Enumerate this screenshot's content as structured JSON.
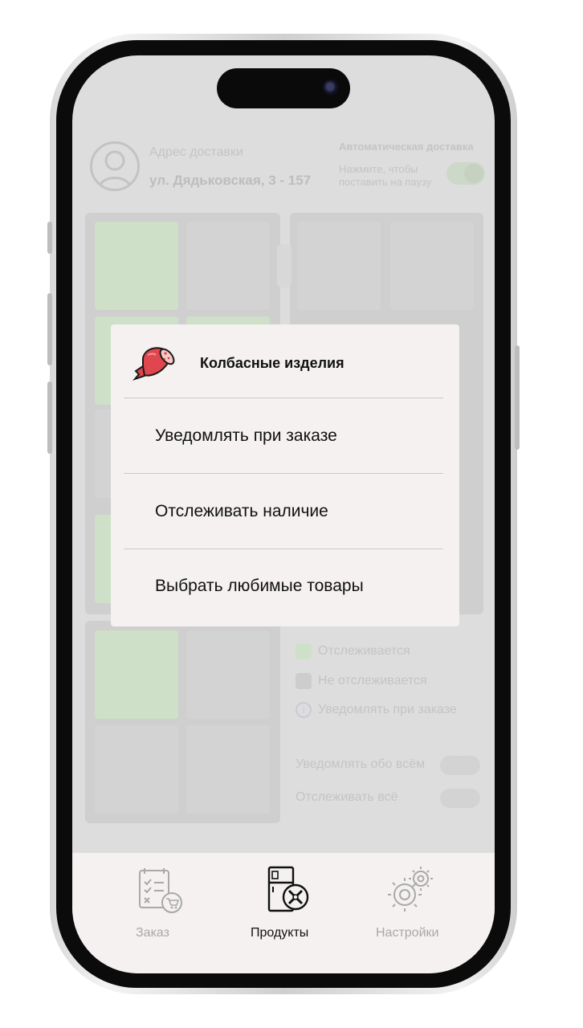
{
  "header": {
    "address_label": "Адрес доставки",
    "address_value": "ул. Дядьковская, 3 - 157",
    "auto_delivery_title": "Автоматическая доставка",
    "auto_delivery_hint_line1": "Нажмите, чтобы",
    "auto_delivery_hint_line2": "поставить на паузу",
    "auto_delivery_on": true
  },
  "legend": {
    "tracked": "Отслеживается",
    "not_tracked": "Не отслеживается",
    "notify_on_order": "Уведомлять при заказе",
    "notify_all": "Уведомлять обо всём",
    "track_all": "Отслеживать всё"
  },
  "modal": {
    "title": "Колбасные изделия",
    "items": [
      "Уведомлять при заказе",
      "Отслеживать наличие",
      "Выбрать любимые товары"
    ]
  },
  "tabbar": {
    "tabs": [
      {
        "label": "Заказ",
        "icon": "order-checklist-icon",
        "active": false
      },
      {
        "label": "Продукты",
        "icon": "fridge-tools-icon",
        "active": true
      },
      {
        "label": "Настройки",
        "icon": "gears-icon",
        "active": false
      }
    ]
  },
  "colors": {
    "overlay_background": "#dddddd",
    "modal_background": "#f4f1f0",
    "tracked_green": "#cfe0c8",
    "active_tab_text": "#111111",
    "inactive_tab_text": "#a9a9a9"
  }
}
